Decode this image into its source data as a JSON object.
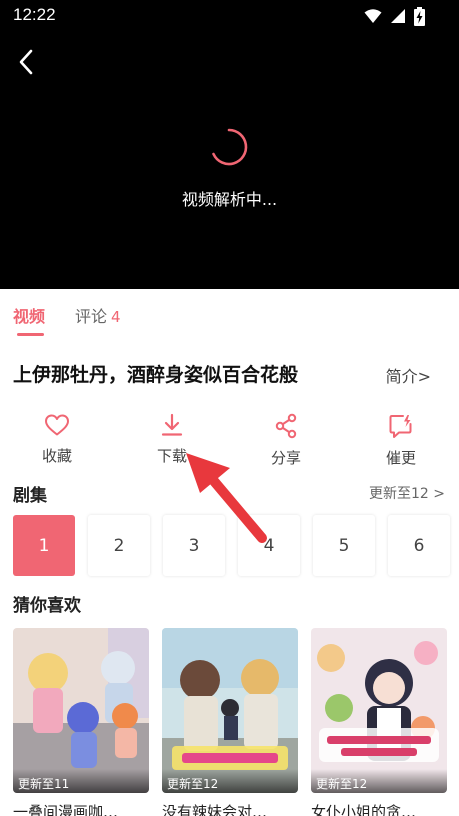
{
  "status_bar": {
    "time": "12:22",
    "icons": [
      "wifi-icon",
      "signal-icon",
      "battery-charging-icon"
    ]
  },
  "player": {
    "loading_text": "视频解析中..."
  },
  "tabs": {
    "video": "视频",
    "comment": "评论",
    "comment_count": "4"
  },
  "video_title": "上伊那牡丹，酒醉身姿似百合花般",
  "intro_label": "简介>",
  "actions": {
    "favorite": "收藏",
    "download": "下载",
    "share": "分享",
    "urge": "催更"
  },
  "episodes": {
    "header": "剧集",
    "update_label": "更新至12 >",
    "items": [
      "1",
      "2",
      "3",
      "4",
      "5",
      "6"
    ],
    "selected": "1"
  },
  "recommendations": {
    "header": "猜你喜欢",
    "items": [
      {
        "badge": "更新至11",
        "title": "一叠间漫画咖…"
      },
      {
        "badge": "更新至12",
        "title": "没有辣妹会对…"
      },
      {
        "badge": "更新至12",
        "title": "女仆小姐的贪…"
      }
    ]
  },
  "colors": {
    "accent": "#f06673",
    "arrow": "#e8383d"
  }
}
